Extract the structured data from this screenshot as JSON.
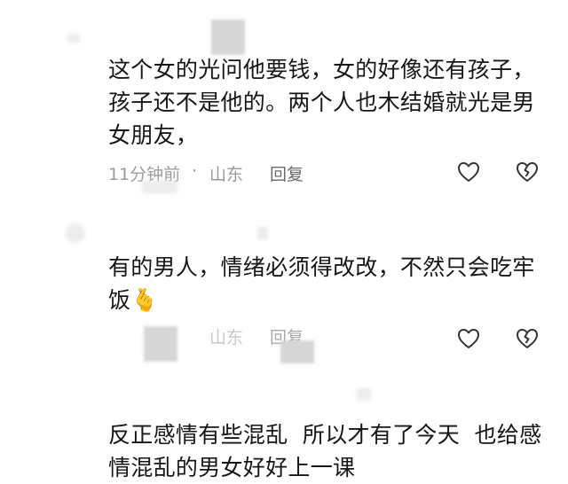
{
  "comments": [
    {
      "text": "这个女的光问他要钱，女的好像还有孩子，孩子还不是他的。两个人也木结婚就光是男女朋友，",
      "time": "11分钟前",
      "separator": "·",
      "location": "山东",
      "reply_label": "回复",
      "like_icon": "heart-outline-icon",
      "dislike_icon": "broken-heart-icon"
    },
    {
      "text": "有的男人，情绪必须得改改，不然只会吃牢饭",
      "emoji": "🫰",
      "time": "",
      "location": "山东",
      "reply_label": "回复",
      "like_icon": "heart-outline-icon",
      "dislike_icon": "broken-heart-icon"
    },
    {
      "text": "反正感情有些混乱  所以才有了今天  也给感情混乱的男女好好上一课"
    }
  ],
  "colors": {
    "text": "#161616",
    "meta": "#9a9a9a",
    "icon": "#333333",
    "emoji_red": "#e8344a",
    "emoji_yellow": "#f4b400"
  }
}
